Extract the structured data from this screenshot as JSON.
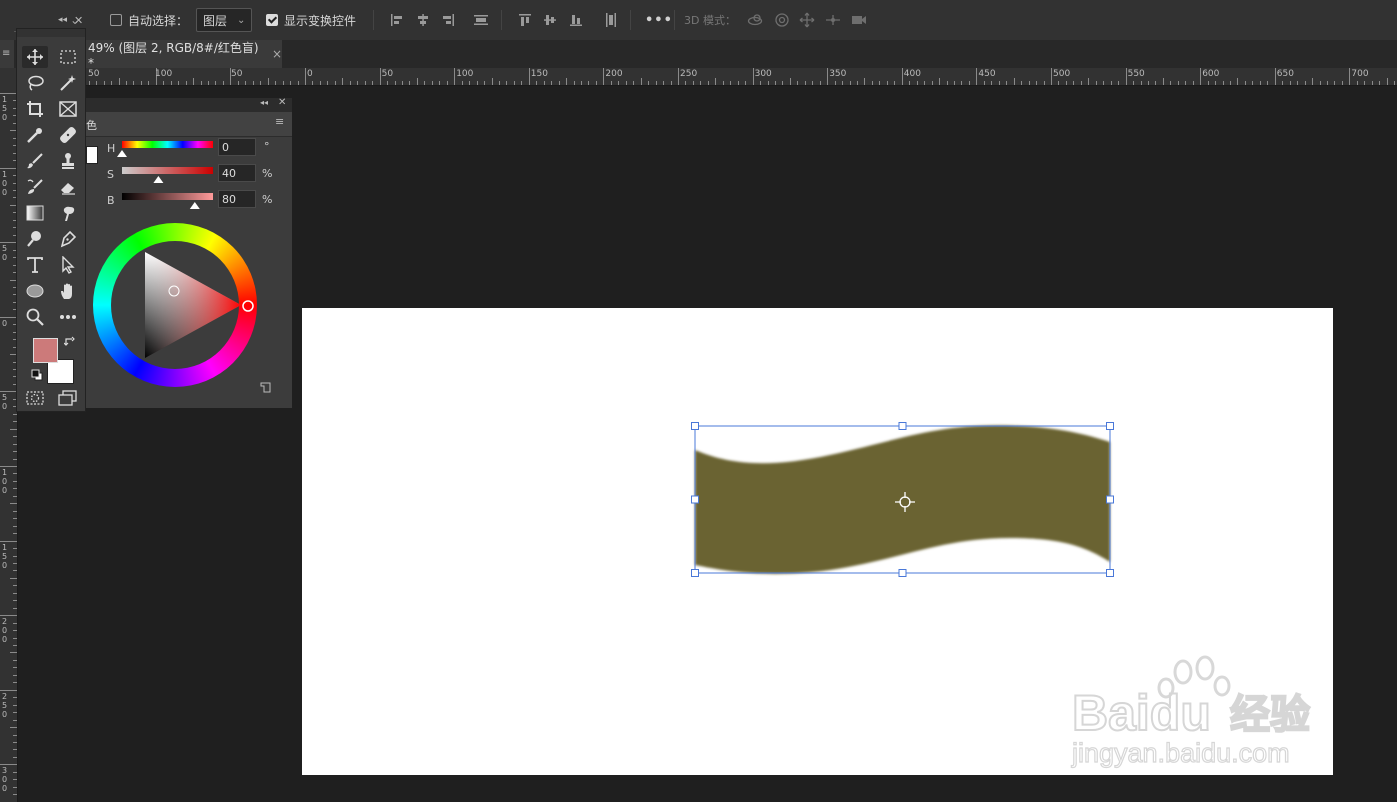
{
  "options_bar": {
    "auto_select_label": "自动选择：",
    "layer_dropdown_value": "图层",
    "show_transform_label": "显示变换控件",
    "more_label": "•••",
    "mode_3d_label": "3D 模式："
  },
  "tab": {
    "left_fragment": "≡",
    "title": "49% (图层 2, RGB/8#/红色盲) *",
    "close": "×"
  },
  "ruler_h": {
    "left_labels": [
      "50",
      "100",
      "50"
    ],
    "labels": [
      "0",
      "50",
      "100",
      "150",
      "200",
      "250",
      "300",
      "350",
      "400",
      "450",
      "500",
      "550",
      "600",
      "650",
      "700"
    ]
  },
  "ruler_v": {
    "labels": [
      "150",
      "100",
      "50",
      "0",
      "50",
      "100",
      "150",
      "200",
      "250",
      "300"
    ]
  },
  "color_panel": {
    "tab_label": "色",
    "h_label": "H",
    "h_value": "0",
    "h_unit": "°",
    "s_label": "S",
    "s_value": "40",
    "s_unit": "%",
    "b_label": "B",
    "b_value": "80",
    "b_unit": "%",
    "sliders": {
      "h": 0,
      "s": 0.4,
      "b": 0.8
    }
  },
  "colors": {
    "foreground": "#cc7a7a",
    "background": "#ffffff",
    "shape_fill": "#6b6330",
    "selection": "#4a78d8"
  },
  "watermark": {
    "brand": "Baidu",
    "brand_cn": "经验",
    "url": "jingyan.baidu.com"
  }
}
